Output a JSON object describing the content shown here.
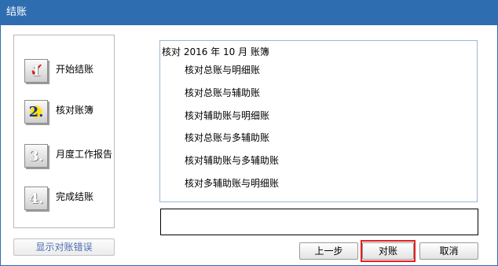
{
  "window": {
    "title": "结账"
  },
  "steps": [
    {
      "label": "开始结账",
      "icon": "checkmark-step-icon",
      "num": "1",
      "state": "done"
    },
    {
      "label": "核对账簿",
      "icon": "step-2-icon",
      "num": "2.",
      "state": "active"
    },
    {
      "label": "月度工作报告",
      "icon": "step-3-icon",
      "num": "3.",
      "state": "pending"
    },
    {
      "label": "完成结账",
      "icon": "step-4-icon",
      "num": "4.",
      "state": "pending"
    }
  ],
  "log": {
    "title": "核对 2016 年 10 月 账簿",
    "items": [
      "核对总账与明细账",
      "核对总账与辅助账",
      "核对辅助账与明细账",
      "核对总账与多辅助账",
      "核对辅助账与多辅助账",
      "核对多辅助账与明细账"
    ]
  },
  "message": {
    "text": ""
  },
  "buttons": {
    "show_errors": "显示对账错误",
    "prev": "上一步",
    "check": "对账",
    "cancel": "取消"
  },
  "colors": {
    "titlebar": "#2e6db0",
    "highlight": "#e02020",
    "step_active": "#1a2e9c"
  }
}
